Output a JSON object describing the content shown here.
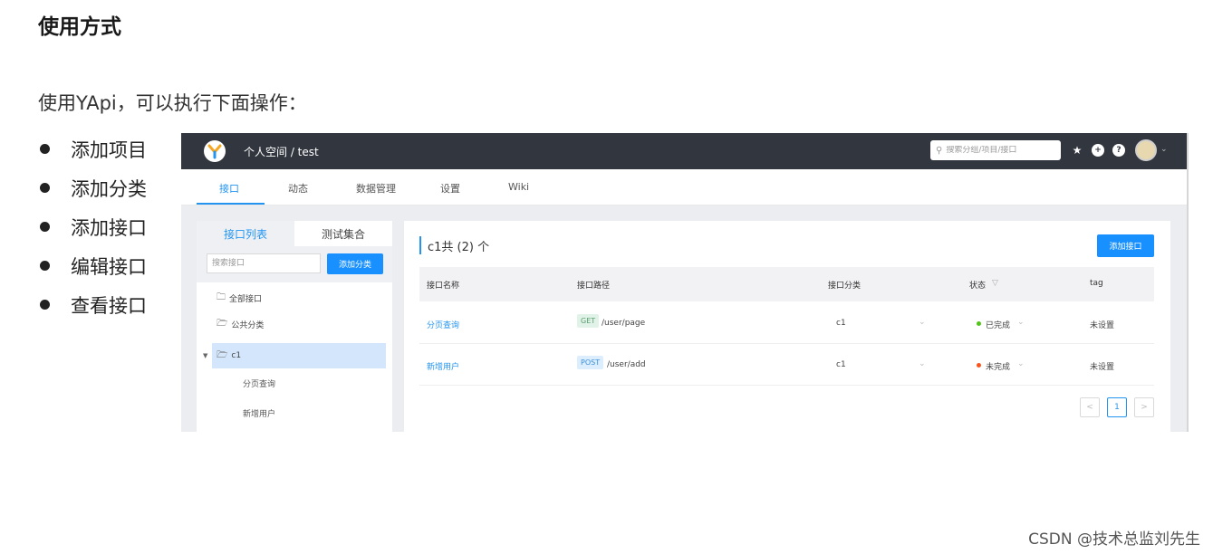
{
  "heading": "使用方式",
  "intro": "使用YApi，可以执行下面操作：",
  "bullets": [
    "添加项目",
    "添加分类",
    "添加接口",
    "编辑接口",
    "查看接口"
  ],
  "watermark": "CSDN @技术总监刘先生",
  "yapi": {
    "breadcrumb": "个人空间 / test",
    "search_placeholder": "搜索分组/项目/接口",
    "tabs": [
      "接口",
      "动态",
      "数据管理",
      "设置",
      "Wiki"
    ],
    "left": {
      "tab_active": "接口列表",
      "tab_other": "测试集合",
      "search_placeholder": "搜索接口",
      "add_category": "添加分类",
      "tree": [
        "全部接口",
        "公共分类",
        "c1"
      ],
      "leaves": [
        "分页查询",
        "新增用户"
      ]
    },
    "right": {
      "title": "c1共 (2) 个",
      "add_button": "添加接口",
      "columns": [
        "接口名称",
        "接口路径",
        "接口分类",
        "状态",
        "tag"
      ],
      "rows": [
        {
          "name": "分页查询",
          "method": "GET",
          "path": "/user/page",
          "category": "c1",
          "status": "已完成",
          "status_color": "#52c41a",
          "tag": "未设置"
        },
        {
          "name": "新增用户",
          "method": "POST",
          "path": "/user/add",
          "category": "c1",
          "status": "未完成",
          "status_color": "#fa541c",
          "tag": "未设置"
        }
      ],
      "pagination": {
        "prev": "<",
        "page": "1",
        "next": ">"
      }
    }
  }
}
